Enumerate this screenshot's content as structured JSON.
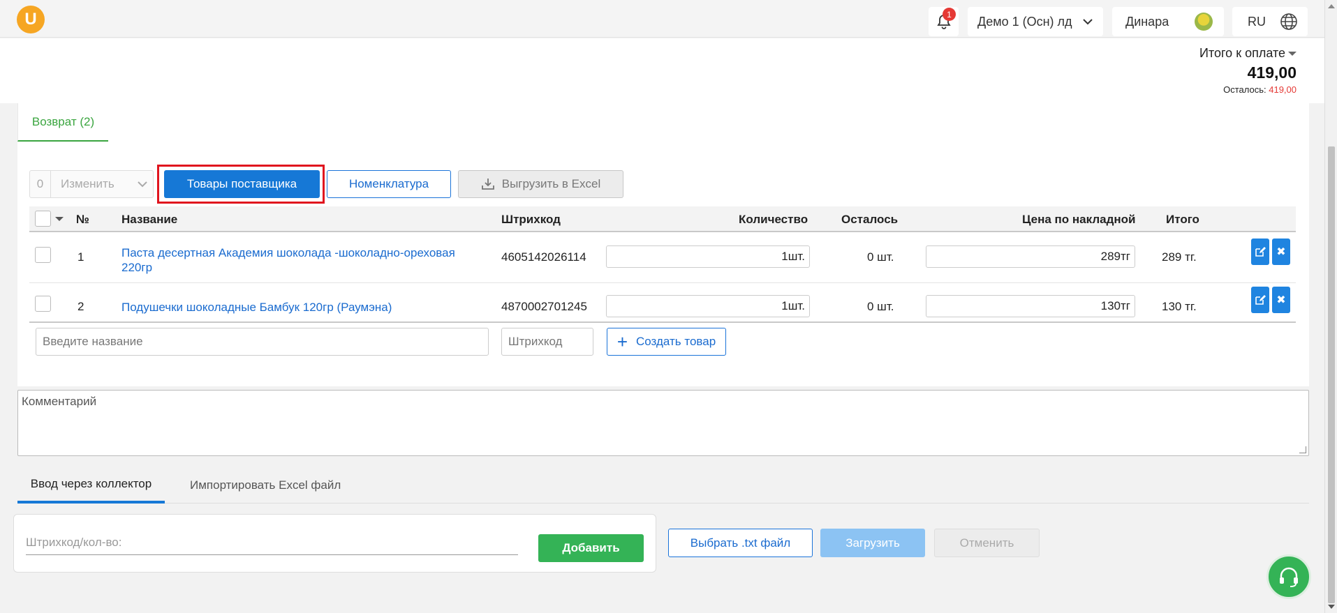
{
  "header": {
    "logo_letter": "U",
    "notifications_count": "1",
    "company": "Демо 1 (Осн) лд",
    "user": "Динара",
    "language": "RU"
  },
  "totals": {
    "label": "Итого к оплате",
    "value": "419,00",
    "remaining_label": "Осталось:",
    "remaining_value": "419,00"
  },
  "tabs": {
    "return_tab": "Возврат (2)"
  },
  "toolbar": {
    "selected_count": "0",
    "change_label": "Изменить",
    "supplier_goods": "Товары поставщика",
    "nomenclature": "Номенклатура",
    "export_excel": "Выгрузить в Excel"
  },
  "table": {
    "headers": {
      "num": "№",
      "name": "Название",
      "barcode": "Штрихкод",
      "quantity": "Количество",
      "remaining": "Осталось",
      "invoice_price": "Цена по накладной",
      "total": "Итого"
    },
    "rows": [
      {
        "num": "1",
        "name": "Паста десертная Академия шоколада -шоколадно-ореховая 220гр",
        "barcode": "4605142026114",
        "quantity": "1шт.",
        "remaining": "0 шт.",
        "price": "289тг",
        "total": "289 тг."
      },
      {
        "num": "2",
        "name": "Подушечки шоколадные Бамбук 120гр (Раумэна)",
        "barcode": "4870002701245",
        "quantity": "1шт.",
        "remaining": "0 шт.",
        "price": "130тг",
        "total": "130 тг."
      }
    ],
    "name_placeholder": "Введите название",
    "barcode_placeholder": "Штрихкод",
    "create_product": "Создать товар"
  },
  "comment_placeholder": "Комментарий",
  "lower_tabs": {
    "collector": "Ввод через коллектор",
    "import_excel": "Импортировать Excel файл"
  },
  "collector": {
    "placeholder": "Штрихкод/кол-во:",
    "add": "Добавить",
    "choose_txt": "Выбрать .txt файл",
    "upload": "Загрузить",
    "cancel": "Отменить"
  },
  "icons": [
    "bell-icon",
    "chevron-down-icon",
    "globe-icon",
    "download-icon",
    "edit-icon",
    "close-icon",
    "plus-icon",
    "headset-icon"
  ],
  "colors": {
    "primary": "#1678d6",
    "success": "#34b356",
    "accent_green": "#3aa53f",
    "danger": "#e53935",
    "logo": "#f6a623"
  }
}
